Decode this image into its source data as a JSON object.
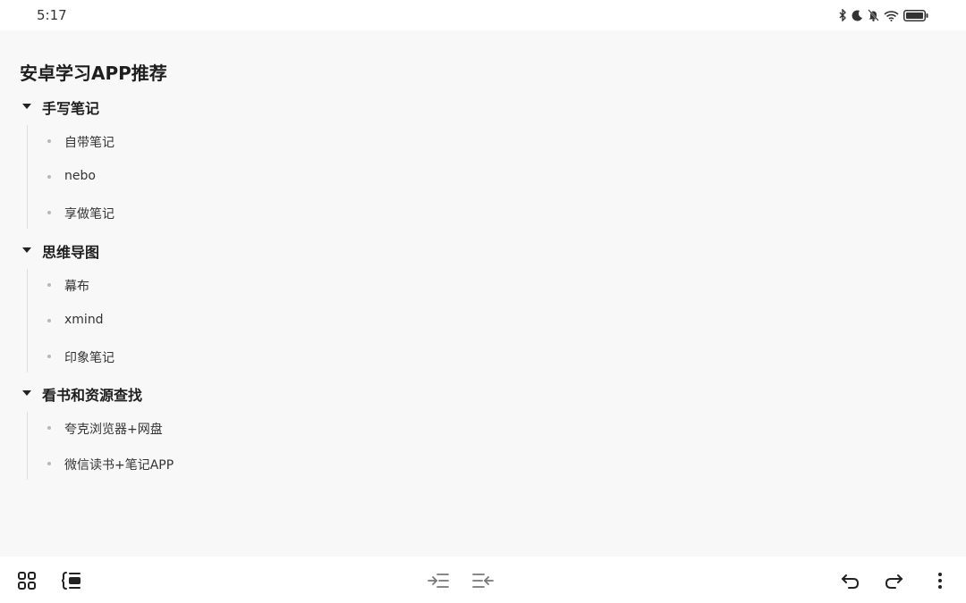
{
  "status": {
    "time": "5:17",
    "icons": [
      "bluetooth-icon",
      "moon-icon",
      "bell-off-icon",
      "wifi-icon",
      "battery-icon"
    ]
  },
  "document": {
    "title": "安卓学习APP推荐",
    "sections": [
      {
        "title": "手写笔记",
        "items": [
          "自带笔记",
          "nebo",
          "享做笔记"
        ]
      },
      {
        "title": "思维导图",
        "items": [
          "幕布",
          "xmind",
          "印象笔记"
        ]
      },
      {
        "title": "看书和资源查找",
        "items": [
          "夸克浏览器+网盘",
          "微信读书+笔记APP"
        ]
      }
    ]
  },
  "toolbar": {
    "left_icons": [
      "grid-icon",
      "outline-icon"
    ],
    "center_icons": [
      "indent-icon",
      "outdent-icon"
    ],
    "right_icons": [
      "undo-icon",
      "redo-icon",
      "more-icon"
    ]
  }
}
